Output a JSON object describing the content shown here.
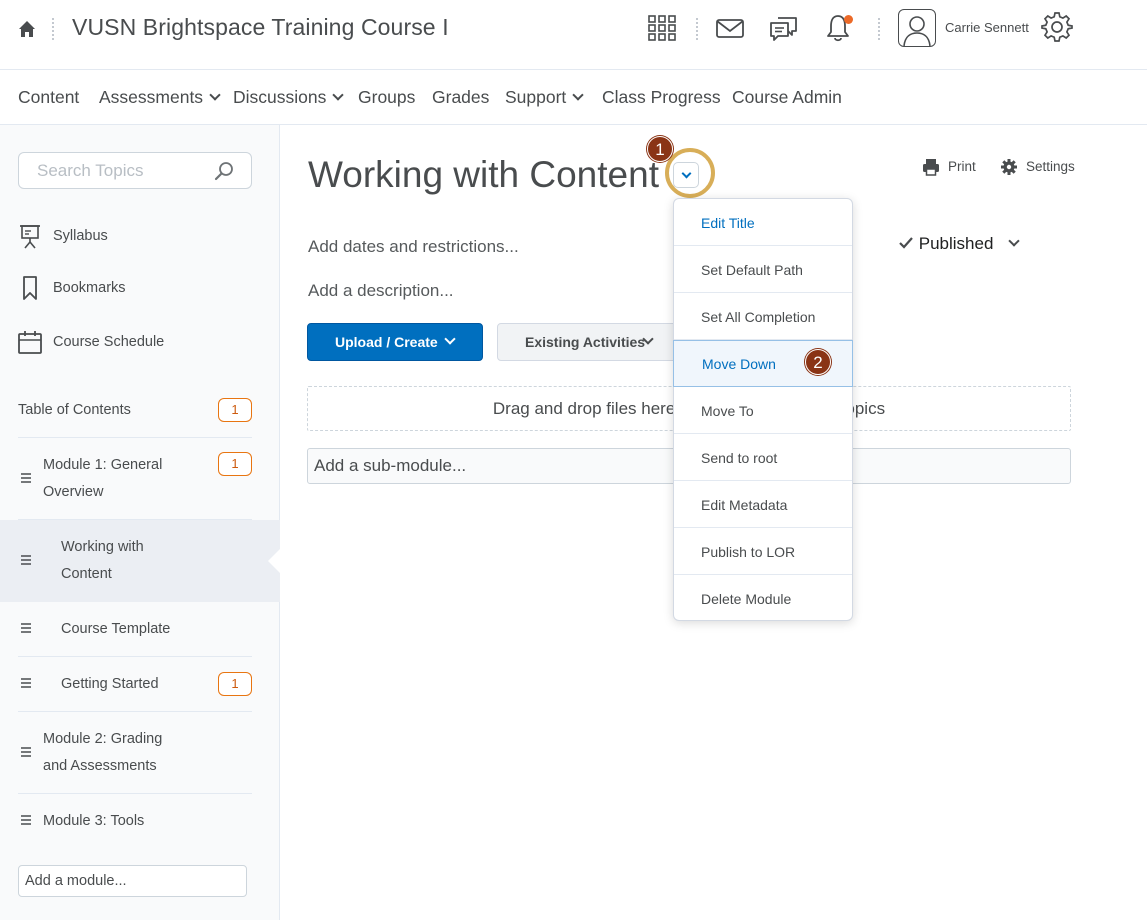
{
  "header": {
    "course_title": "VUSN Brightspace Training Course I",
    "user_name": "Carrie Sennett",
    "icons": [
      "home-icon",
      "waffle-grid-icon",
      "mail-icon",
      "chat-icon",
      "bell-icon",
      "avatar-icon",
      "gear-icon"
    ],
    "notification_color": "#ec6a28"
  },
  "nav": {
    "items": [
      {
        "label": "Content"
      },
      {
        "label": "Assessments"
      },
      {
        "label": "Discussions"
      },
      {
        "label": "Groups"
      },
      {
        "label": "Grades"
      },
      {
        "label": "Support"
      },
      {
        "label": "Class Progress"
      },
      {
        "label": "Course Admin"
      }
    ]
  },
  "sidebar": {
    "search_placeholder": "Search Topics",
    "links": [
      {
        "label": "Syllabus",
        "icon": "presentation-icon"
      },
      {
        "label": "Bookmarks",
        "icon": "bookmark-icon"
      },
      {
        "label": "Course Schedule",
        "icon": "calendar-icon"
      }
    ],
    "toc": {
      "label": "Table of Contents",
      "count": "1"
    },
    "modules": [
      {
        "line1": "Module 1: General",
        "line2": "Overview",
        "count": "1"
      },
      {
        "line1": "Working with",
        "line2": "Content"
      },
      {
        "label": "Course Template"
      },
      {
        "label": "Getting Started",
        "count": "1"
      },
      {
        "line1": "Module 2: Grading",
        "line2": "and Assessments"
      },
      {
        "label": "Module 3: Tools"
      }
    ],
    "add_module_placeholder": "Add a module..."
  },
  "main": {
    "title": "Working with Content",
    "print_label": "Print",
    "settings_label": "Settings",
    "dates_text": "Add dates and restrictions...",
    "description_text": "Add a description...",
    "status": "Published",
    "upload_button": "Upload / Create",
    "existing_button": "Existing Activities",
    "drop_text": "Drag and drop files here to create and update topics",
    "submodule_placeholder": "Add a sub-module...",
    "accent_color": "#006fbf"
  },
  "context_menu": {
    "items": [
      "Edit Title",
      "Set Default Path",
      "Set All Completion",
      "Move Down",
      "Move To",
      "Send to root",
      "Edit Metadata",
      "Publish to LOR",
      "Delete Module"
    ]
  },
  "callouts": {
    "step1": "1",
    "step2": "2",
    "color": "#8a3415"
  }
}
